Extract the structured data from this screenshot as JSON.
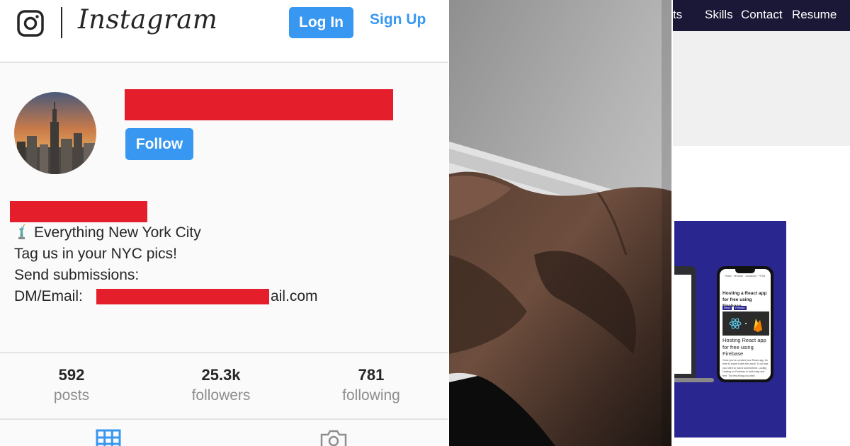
{
  "instagram": {
    "header": {
      "logo_icon": "instagram-camera-icon",
      "wordmark": "Instagram",
      "login_label": "Log In",
      "signup_label": "Sign Up"
    },
    "profile": {
      "follow_label": "Follow",
      "bio": {
        "line1": "Everything New York City",
        "line2": "Tag us in your NYC pics!",
        "line3": "Send submissions:",
        "line4_prefix": "DM/Email: ",
        "line4_suffix": "ail.com",
        "statue_icon": "statue-of-liberty-icon"
      }
    },
    "stats": [
      {
        "value": "592",
        "label": "posts"
      },
      {
        "value": "25.3k",
        "label": "followers"
      },
      {
        "value": "781",
        "label": "following"
      }
    ],
    "tabs": [
      "grid-icon",
      "tagged-camera-icon"
    ],
    "colors": {
      "button_blue": "#3897f0",
      "redaction": "#e41e2a",
      "muted": "#8e8e8e"
    }
  },
  "portfolio": {
    "nav": {
      "projects_fragment": "ects",
      "skills": "Skills",
      "contact": "Contact",
      "resume": "Resume"
    },
    "phone_preview": {
      "nav": "React · Firebase · Javascript · HTML",
      "title": "Hosting a React app for free using Firebase",
      "tag1": "React",
      "tag2": "Firebase",
      "heading": "Hosting React app for free using Firebase",
      "body": "Once you've created your React app, its time to share it with the world. To do that, you need to host it somewhere. Luckily, Hosting on Firebase is both easy and free. The first thing you need"
    },
    "colors": {
      "nav_bg": "#1b1736",
      "card_bg": "#2a2690"
    }
  }
}
